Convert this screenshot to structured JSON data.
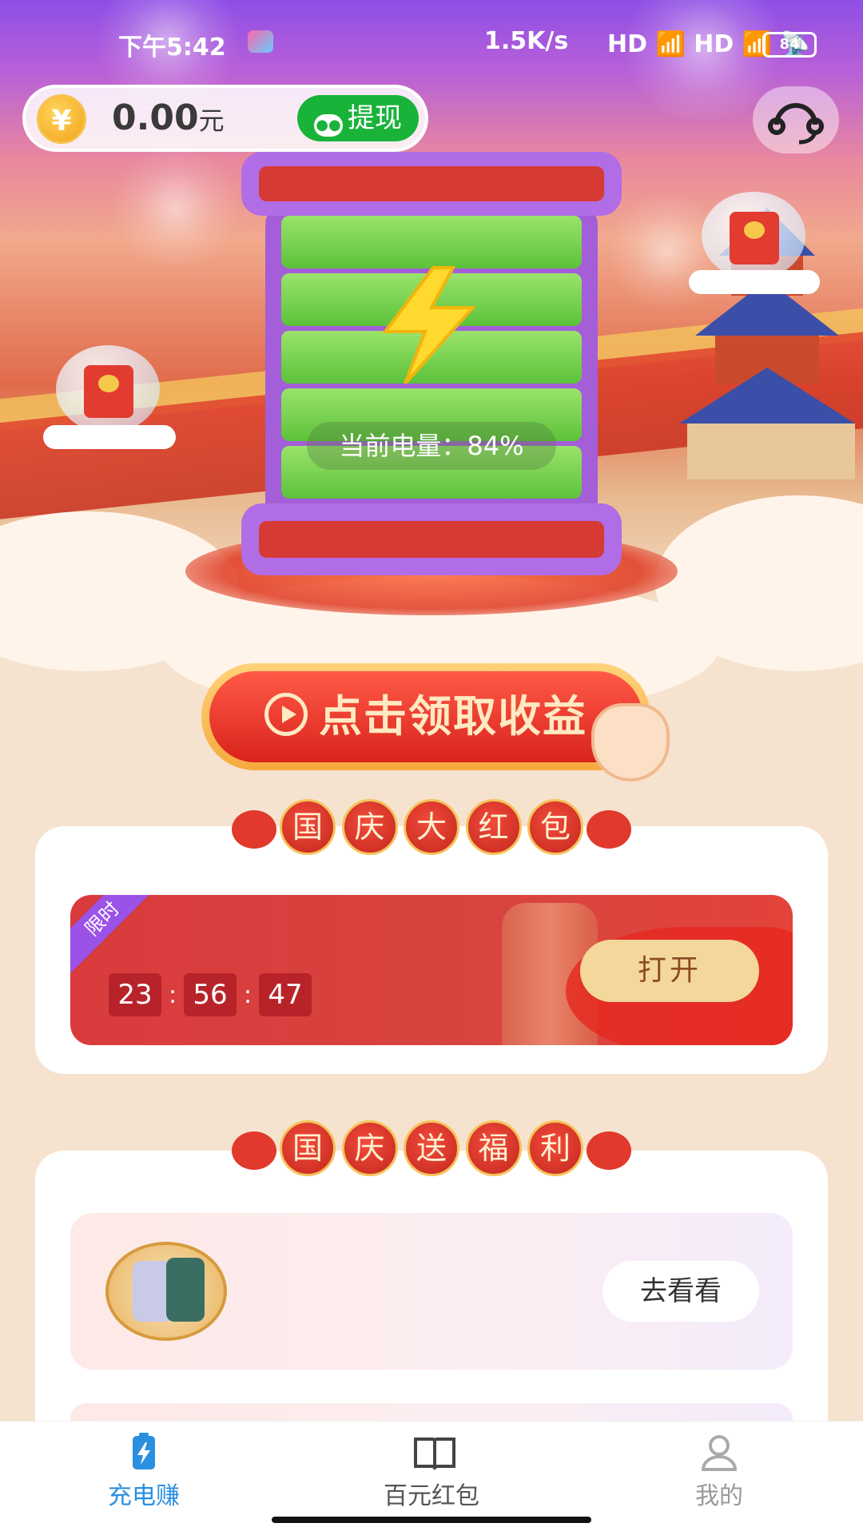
{
  "status_bar": {
    "time": "下午5:42",
    "network_speed": "1.5K/s",
    "signal": "HD 📶 HD 📶 📡",
    "battery_level": "84"
  },
  "header": {
    "balance_symbol": "¥",
    "balance_value": "0.00",
    "balance_unit": "元",
    "withdraw_label": "提现",
    "support_icon": "headset-icon"
  },
  "battery_display": {
    "charge_text": "当前电量：84%",
    "charge_percent": 84
  },
  "cta": {
    "label": "点击领取收益"
  },
  "section_red_packet": {
    "title_chars": [
      "国",
      "庆",
      "大",
      "红",
      "包"
    ],
    "limited_tag": "限时",
    "timer": {
      "hours": "23",
      "minutes": "56",
      "seconds": "47",
      "separator": ":"
    },
    "open_button": "打开"
  },
  "section_welfare": {
    "title_chars": [
      "国",
      "庆",
      "送",
      "福",
      "利"
    ],
    "items": [
      {
        "action": "去看看"
      }
    ]
  },
  "tabbar": {
    "tabs": [
      {
        "label": "充电赚",
        "icon": "battery-charge-icon",
        "active": true
      },
      {
        "label": "百元红包",
        "icon": "book-icon",
        "active": false
      },
      {
        "label": "我的",
        "icon": "user-icon",
        "active": false
      }
    ]
  },
  "colors": {
    "accent_red": "#d9231c",
    "active_tab": "#2b8fe0",
    "withdraw_green": "#19b33a",
    "purple": "#a35ed8"
  }
}
